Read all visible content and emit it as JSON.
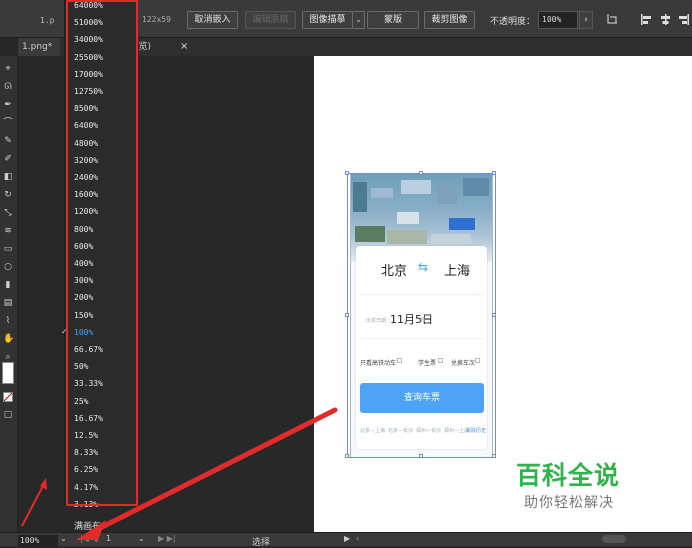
{
  "options_bar": {
    "file_label": "1.p",
    "size_label": "122x59",
    "buttons": [
      "取消嵌入",
      "编辑原稿",
      "图像描摹",
      "蒙版",
      "裁剪图像"
    ],
    "opacity_label": "不透明度：",
    "opacity_value": "100%",
    "opacity_arrow": "›"
  },
  "tabs": {
    "tab1_label": "1.png*",
    "tab2_label": "U 预览)",
    "close_glyph": "×"
  },
  "zoom_menu": {
    "items": [
      "64000%",
      "51000%",
      "34000%",
      "25500%",
      "17000%",
      "12750%",
      "8500%",
      "6400%",
      "4800%",
      "3200%",
      "2400%",
      "1600%",
      "1200%",
      "800%",
      "600%",
      "400%",
      "300%",
      "200%",
      "150%",
      "100%",
      "66.67%",
      "50%",
      "33.33%",
      "25%",
      "16.67%",
      "12.5%",
      "8.33%",
      "6.25%",
      "4.17%",
      "3.13%"
    ],
    "selected_index": 19,
    "checkmark": "✓",
    "fit_label": "满画布"
  },
  "status_bar": {
    "zoom_value": "100%",
    "zoom_caret": "⌄",
    "nav_prev": "|◀ ◀",
    "page_value": "1",
    "page_caret": "⌄",
    "nav_next": "▶ ▶|",
    "tool_label": "选择",
    "play": "▶",
    "back": "‹"
  },
  "phone_mock": {
    "from_city": "北京",
    "swap_icon": "⇆",
    "to_city": "上海",
    "date_caption": "出发日期",
    "date": "11月5日",
    "weekday": "周一",
    "options": [
      "只看高铁动车",
      "学生票",
      "兑换车次"
    ],
    "search_label": "查询车票",
    "history": [
      "北京—上海",
      "北京—长沙",
      "郑州—长沙",
      "郑州—上海",
      "清除历史"
    ]
  },
  "watermark": {
    "title": "百科全说",
    "subtitle": "助你轻松解决"
  },
  "colors": {
    "annotation_red": "#e32a2a",
    "selected_blue": "#3da2ff",
    "watermark_green": "#31b24a",
    "search_button": "#4fa3f7"
  }
}
